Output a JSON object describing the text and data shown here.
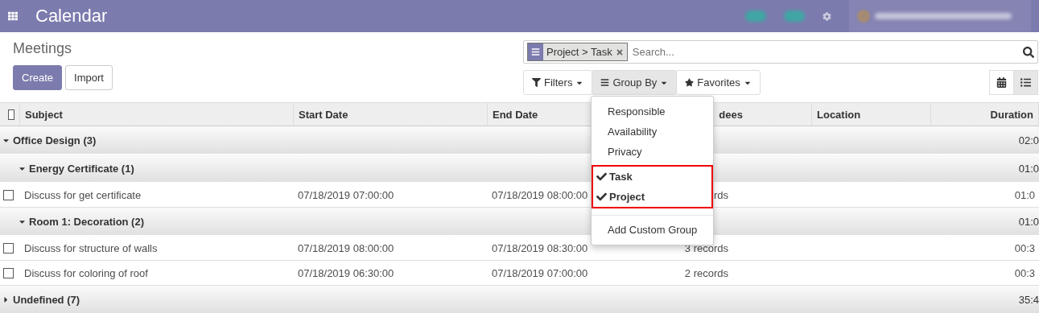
{
  "app": {
    "title": "Calendar"
  },
  "breadcrumb": "Meetings",
  "buttons": [
    {
      "label": "Create",
      "kind": "primary"
    },
    {
      "label": "Import",
      "kind": "secondary"
    }
  ],
  "search": {
    "facet": "Project > Task",
    "placeholder": "Search..."
  },
  "filters": [
    {
      "label": "Filters",
      "kind": "filter",
      "selected": false
    },
    {
      "label": "Group By",
      "kind": "group",
      "selected": true
    },
    {
      "label": "Favorites",
      "kind": "star",
      "selected": false
    }
  ],
  "views": [
    {
      "kind": "calendar",
      "selected": false
    },
    {
      "kind": "list",
      "selected": true
    }
  ],
  "groupby_menu": {
    "items": [
      {
        "label": "Responsible",
        "checked": false
      },
      {
        "label": "Availability",
        "checked": false
      },
      {
        "label": "Privacy",
        "checked": false
      },
      {
        "label": "Task",
        "checked": true
      },
      {
        "label": "Project",
        "checked": true
      }
    ],
    "custom": "Add Custom Group"
  },
  "table": {
    "select_all": {
      "checked": false
    },
    "columns": [
      "Subject",
      "Start Date",
      "End Date",
      "dees",
      "Location",
      "Duration"
    ],
    "rows": [
      {
        "kind": "group",
        "label": "Office Design (3)",
        "duration": "02:0",
        "expanded": true,
        "children": [
          {
            "kind": "group",
            "label": "Energy Certificate (1)",
            "duration": "01:0",
            "expanded": true,
            "children": [
              {
                "kind": "record",
                "checked": false,
                "subject": "Discuss for get certificate",
                "start": "07/18/2019 07:00:00",
                "end": "07/18/2019 08:00:00",
                "attendees": "rds",
                "duration": "01:0"
              }
            ]
          },
          {
            "kind": "group",
            "label": "Room 1: Decoration (2)",
            "duration": "01:0",
            "expanded": true,
            "children": [
              {
                "kind": "record",
                "checked": false,
                "subject": "Discuss for structure of walls",
                "start": "07/18/2019 08:00:00",
                "end": "07/18/2019 08:30:00",
                "attendees": "3 records",
                "duration": "00:3"
              },
              {
                "kind": "record",
                "checked": false,
                "subject": "Discuss for coloring of roof",
                "start": "07/18/2019 06:30:00",
                "end": "07/18/2019 07:00:00",
                "attendees": "2 records",
                "duration": "00:3"
              }
            ]
          }
        ]
      },
      {
        "kind": "group",
        "label": "Undefined (7)",
        "duration": "35:4",
        "expanded": false,
        "children": []
      }
    ]
  }
}
